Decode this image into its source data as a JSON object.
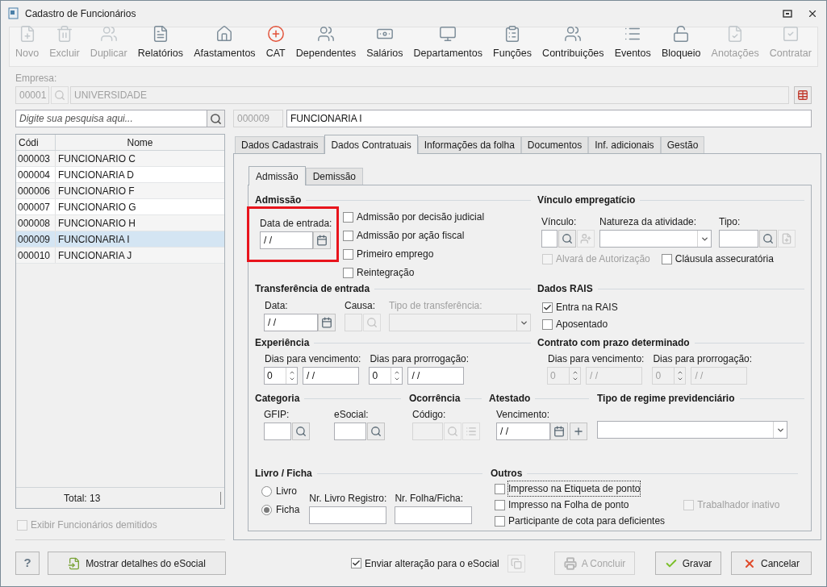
{
  "window": {
    "title": "Cadastro de Funcionários"
  },
  "toolbar": [
    {
      "label": "Novo",
      "disabled": true
    },
    {
      "label": "Excluir",
      "disabled": true
    },
    {
      "label": "Duplicar",
      "disabled": true
    },
    {
      "label": "Relatórios",
      "disabled": false
    },
    {
      "label": "Afastamentos",
      "disabled": false
    },
    {
      "label": "CAT",
      "disabled": false
    },
    {
      "label": "Dependentes",
      "disabled": false
    },
    {
      "label": "Salários",
      "disabled": false
    },
    {
      "label": "Departamentos",
      "disabled": false
    },
    {
      "label": "Funções",
      "disabled": false
    },
    {
      "label": "Contribuições",
      "disabled": false
    },
    {
      "label": "Eventos",
      "disabled": false
    },
    {
      "label": "Bloqueio",
      "disabled": false
    },
    {
      "label": "Anotações",
      "disabled": true
    },
    {
      "label": "Contratar",
      "disabled": true
    }
  ],
  "empresa": {
    "label": "Empresa:",
    "code": "00001",
    "name": "UNIVERSIDADE",
    "disabled": true
  },
  "search": {
    "placeholder": "Digite sua pesquisa aqui..."
  },
  "employee": {
    "code": "000009",
    "name": "FUNCIONARIA I"
  },
  "list": {
    "columns": [
      "Códi",
      "Nome"
    ],
    "rows": [
      {
        "code": "000003",
        "name": "FUNCIONARIO C",
        "selected": false
      },
      {
        "code": "000004",
        "name": "FUNCIONARIA D",
        "selected": false
      },
      {
        "code": "000006",
        "name": "FUNCIONARIO F",
        "selected": false
      },
      {
        "code": "000007",
        "name": "FUNCIONARIO G",
        "selected": false
      },
      {
        "code": "000008",
        "name": "FUNCIONARIO H",
        "selected": false
      },
      {
        "code": "000009",
        "name": "FUNCIONARIA I",
        "selected": true
      },
      {
        "code": "000010",
        "name": "FUNCIONARIA J",
        "selected": false
      }
    ],
    "total": "Total: 13"
  },
  "show_dismissed": {
    "label": "Exibir Funcionários demitidos",
    "checked": false,
    "disabled": true
  },
  "tabs": [
    {
      "label": "Dados Cadastrais",
      "selected": false
    },
    {
      "label": "Dados Contratuais",
      "selected": true
    },
    {
      "label": "Informações da folha",
      "selected": false
    },
    {
      "label": "Documentos",
      "selected": false
    },
    {
      "label": "Inf. adicionais",
      "selected": false
    },
    {
      "label": "Gestão",
      "selected": false
    }
  ],
  "subtabs": [
    {
      "label": "Admissão",
      "selected": true
    },
    {
      "label": "Demissão",
      "selected": false
    }
  ],
  "admissao": {
    "title": "Admissão",
    "date_label": "Data de entrada:",
    "date_value": "/ /",
    "highlighted": true,
    "options": [
      {
        "label": "Admissão por decisão judicial",
        "checked": false
      },
      {
        "label": "Admissão por ação fiscal",
        "checked": false
      },
      {
        "label": "Primeiro emprego",
        "checked": false
      },
      {
        "label": "Reintegração",
        "checked": false
      }
    ]
  },
  "vinculo": {
    "title": "Vínculo empregatício",
    "vinculo_label": "Vínculo:",
    "natureza_label": "Natureza da atividade:",
    "tipo_label": "Tipo:",
    "options": [
      {
        "label": "Alvará de Autorização",
        "checked": false,
        "disabled": true
      },
      {
        "label": "Cláusula assecuratória",
        "checked": false,
        "disabled": false
      }
    ]
  },
  "transferencia": {
    "title": "Transferência de entrada",
    "data_label": "Data:",
    "data_value": "/ /",
    "causa_label": "Causa:",
    "causa_disabled": true,
    "tipo_label": "Tipo de transferência:",
    "tipo_disabled": true
  },
  "rais": {
    "title": "Dados RAIS",
    "options": [
      {
        "label": "Entra na RAIS",
        "checked": true
      },
      {
        "label": "Aposentado",
        "checked": false
      }
    ]
  },
  "experiencia": {
    "title": "Experiência",
    "fields": [
      {
        "label": "Dias para vencimento:",
        "days": "0",
        "date": "/ /",
        "disabled": false
      },
      {
        "label": "Dias para prorrogação:",
        "days": "0",
        "date": "/ /",
        "disabled": false
      }
    ]
  },
  "contrato": {
    "title": "Contrato com prazo determinado",
    "fields": [
      {
        "label": "Dias para vencimento:",
        "days": "0",
        "date": "/ /",
        "disabled": true
      },
      {
        "label": "Dias para prorrogação:",
        "days": "0",
        "date": "/ /",
        "disabled": true
      }
    ]
  },
  "categoria": {
    "title": "Categoria",
    "fields": [
      "GFIP:",
      "eSocial:"
    ]
  },
  "ocorrencia": {
    "title": "Ocorrência",
    "label": "Código:",
    "disabled": true
  },
  "atestado": {
    "title": "Atestado",
    "label": "Vencimento:",
    "value": "/ /"
  },
  "regime": {
    "title": "Tipo de regime previdenciário"
  },
  "livro": {
    "title": "Livro / Ficha",
    "options": [
      {
        "label": "Livro",
        "selected": false
      },
      {
        "label": "Ficha",
        "selected": true
      }
    ],
    "fields": [
      "Nr. Livro Registro:",
      "Nr. Folha/Ficha:"
    ]
  },
  "outros": {
    "title": "Outros",
    "options": [
      {
        "label": "Impresso na Etiqueta de ponto",
        "checked": false,
        "focused": true
      },
      {
        "label": "Impresso na Folha de ponto",
        "checked": false,
        "focused": false
      },
      {
        "label": "Participante de cota para deficientes",
        "checked": false,
        "focused": false
      }
    ],
    "inactive": {
      "label": "Trabalhador inativo",
      "checked": false,
      "disabled": true
    }
  },
  "footer": {
    "help": "?",
    "details": "Mostrar detalhes do eSocial",
    "send": {
      "label": "Enviar alteração para o eSocial",
      "checked": true
    },
    "buttons": [
      {
        "label": "A Concluir",
        "kind": "conclude",
        "disabled": true
      },
      {
        "label": "Gravar",
        "kind": "save",
        "disabled": false
      },
      {
        "label": "Cancelar",
        "kind": "cancel",
        "disabled": false
      }
    ]
  }
}
